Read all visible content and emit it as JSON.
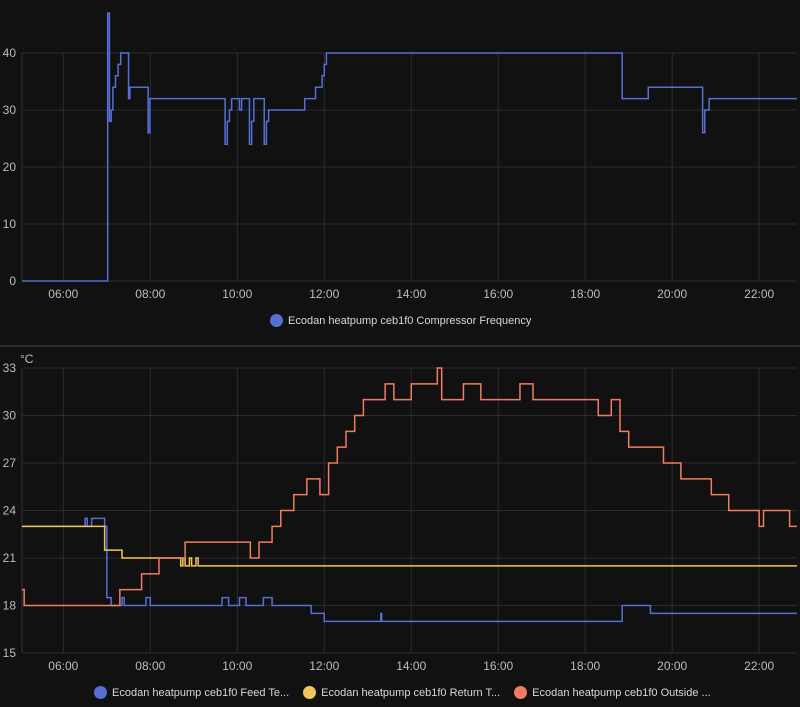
{
  "chart_data": [
    {
      "type": "line",
      "title": "",
      "ylabel": "",
      "ylim": [
        0,
        40
      ],
      "yticks": [
        0,
        10,
        20,
        30,
        40
      ],
      "xlim": [
        5.05,
        22.87
      ],
      "xticks": [
        "06:00",
        "08:00",
        "10:00",
        "12:00",
        "14:00",
        "16:00",
        "18:00",
        "20:00",
        "22:00"
      ],
      "series": [
        {
          "name": "Ecodan heatpump ceb1f0 Compressor Frequency",
          "color": "#5470d6",
          "points": [
            [
              5.05,
              0
            ],
            [
              7.0,
              0
            ],
            [
              7.02,
              47
            ],
            [
              7.06,
              28
            ],
            [
              7.1,
              30
            ],
            [
              7.14,
              34
            ],
            [
              7.2,
              36
            ],
            [
              7.26,
              38
            ],
            [
              7.32,
              40
            ],
            [
              7.5,
              32
            ],
            [
              7.53,
              34
            ],
            [
              7.95,
              26
            ],
            [
              7.99,
              32
            ],
            [
              9.72,
              24
            ],
            [
              9.77,
              28
            ],
            [
              9.82,
              30
            ],
            [
              9.87,
              32
            ],
            [
              10.05,
              30
            ],
            [
              10.1,
              32
            ],
            [
              10.28,
              24
            ],
            [
              10.33,
              28
            ],
            [
              10.38,
              32
            ],
            [
              10.62,
              24
            ],
            [
              10.67,
              28
            ],
            [
              10.72,
              30
            ],
            [
              11.55,
              32
            ],
            [
              11.8,
              34
            ],
            [
              11.95,
              36
            ],
            [
              12.0,
              38
            ],
            [
              12.05,
              40
            ],
            [
              18.85,
              32
            ],
            [
              19.45,
              34
            ],
            [
              20.7,
              26
            ],
            [
              20.75,
              30
            ],
            [
              20.85,
              32
            ],
            [
              22.87,
              32
            ]
          ]
        }
      ]
    },
    {
      "type": "line",
      "title": "",
      "ylabel": "°C",
      "ylim": [
        15,
        33
      ],
      "yticks": [
        15,
        18,
        21,
        24,
        27,
        30,
        33
      ],
      "xlim": [
        5.05,
        22.87
      ],
      "xticks": [
        "06:00",
        "08:00",
        "10:00",
        "12:00",
        "14:00",
        "16:00",
        "18:00",
        "20:00",
        "22:00"
      ],
      "series": [
        {
          "name": "Ecodan heatpump ceb1f0 Feed Te...",
          "color": "#5470d6",
          "points": [
            [
              5.05,
              23
            ],
            [
              6.5,
              23.5
            ],
            [
              6.55,
              23
            ],
            [
              6.65,
              23.5
            ],
            [
              6.95,
              23
            ],
            [
              7.0,
              18.5
            ],
            [
              7.1,
              18
            ],
            [
              7.35,
              18.5
            ],
            [
              7.4,
              18
            ],
            [
              7.9,
              18.5
            ],
            [
              8.0,
              18
            ],
            [
              9.65,
              18.5
            ],
            [
              9.8,
              18
            ],
            [
              10.05,
              18.5
            ],
            [
              10.2,
              18
            ],
            [
              10.6,
              18.5
            ],
            [
              10.8,
              18
            ],
            [
              11.7,
              17.5
            ],
            [
              12.0,
              17
            ],
            [
              13.3,
              17.5
            ],
            [
              13.32,
              17
            ],
            [
              18.85,
              18
            ],
            [
              19.5,
              17.5
            ],
            [
              20.6,
              17.5
            ],
            [
              22.87,
              17.5
            ]
          ]
        },
        {
          "name": "Ecodan heatpump ceb1f0 Return T...",
          "color": "#f2c55c",
          "points": [
            [
              5.05,
              23
            ],
            [
              6.95,
              21.5
            ],
            [
              7.35,
              21
            ],
            [
              8.7,
              20.5
            ],
            [
              8.75,
              21
            ],
            [
              8.8,
              20.5
            ],
            [
              8.9,
              21
            ],
            [
              8.95,
              20.5
            ],
            [
              9.05,
              21
            ],
            [
              9.1,
              20.5
            ],
            [
              22.87,
              20.5
            ]
          ]
        },
        {
          "name": "Ecodan heatpump ceb1f0 Outside ...",
          "color": "#f07c62",
          "points": [
            [
              5.05,
              19
            ],
            [
              5.1,
              18
            ],
            [
              7.3,
              19
            ],
            [
              7.8,
              20
            ],
            [
              8.2,
              21
            ],
            [
              8.8,
              22
            ],
            [
              10.3,
              21
            ],
            [
              10.5,
              22
            ],
            [
              10.8,
              23
            ],
            [
              11.0,
              24
            ],
            [
              11.3,
              25
            ],
            [
              11.6,
              26
            ],
            [
              11.9,
              25
            ],
            [
              12.1,
              27
            ],
            [
              12.3,
              28
            ],
            [
              12.5,
              29
            ],
            [
              12.7,
              30
            ],
            [
              12.9,
              31
            ],
            [
              13.4,
              32
            ],
            [
              13.6,
              31
            ],
            [
              14.0,
              32
            ],
            [
              14.6,
              33
            ],
            [
              14.7,
              31
            ],
            [
              15.2,
              32
            ],
            [
              15.6,
              31
            ],
            [
              16.5,
              32
            ],
            [
              16.8,
              31
            ],
            [
              18.3,
              30
            ],
            [
              18.6,
              31
            ],
            [
              18.8,
              29
            ],
            [
              19.0,
              28
            ],
            [
              19.8,
              27
            ],
            [
              20.2,
              26
            ],
            [
              20.9,
              25
            ],
            [
              21.3,
              24
            ],
            [
              22.0,
              23
            ],
            [
              22.1,
              24
            ],
            [
              22.7,
              23
            ],
            [
              22.87,
              23
            ]
          ]
        }
      ]
    }
  ]
}
